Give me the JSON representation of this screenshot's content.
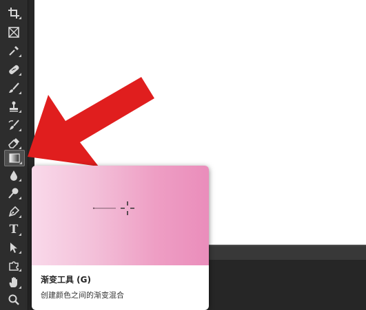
{
  "toolbar": {
    "tools": [
      {
        "name": "crop-tool",
        "icon": "crop-icon"
      },
      {
        "name": "frame-tool",
        "icon": "frame-icon"
      },
      {
        "name": "eyedropper-tool",
        "icon": "eyedropper-icon"
      },
      {
        "name": "healing-brush-tool",
        "icon": "bandage-icon"
      },
      {
        "name": "brush-tool",
        "icon": "brush-icon"
      },
      {
        "name": "clone-stamp-tool",
        "icon": "stamp-icon"
      },
      {
        "name": "history-brush-tool",
        "icon": "history-brush-icon"
      },
      {
        "name": "eraser-tool",
        "icon": "eraser-icon"
      },
      {
        "name": "gradient-tool",
        "icon": "gradient-icon",
        "active": true
      },
      {
        "name": "blur-tool",
        "icon": "drop-icon"
      },
      {
        "name": "dodge-tool",
        "icon": "dodge-icon"
      },
      {
        "name": "pen-tool",
        "icon": "pen-icon"
      },
      {
        "name": "type-tool",
        "icon": "type-icon",
        "glyph": "T"
      },
      {
        "name": "path-selection-tool",
        "icon": "arrow-cursor-icon"
      },
      {
        "name": "custom-shape-tool",
        "icon": "puzzle-icon"
      },
      {
        "name": "hand-tool",
        "icon": "hand-icon"
      },
      {
        "name": "zoom-tool",
        "icon": "magnifier-icon"
      }
    ]
  },
  "tooltip": {
    "title": "渐变工具 (G)",
    "description": "创建颜色之间的渐变混合"
  },
  "colors": {
    "arrow": "#e01e1e",
    "gradient_start": "#f9d9ea",
    "gradient_end": "#ea8dbb"
  }
}
